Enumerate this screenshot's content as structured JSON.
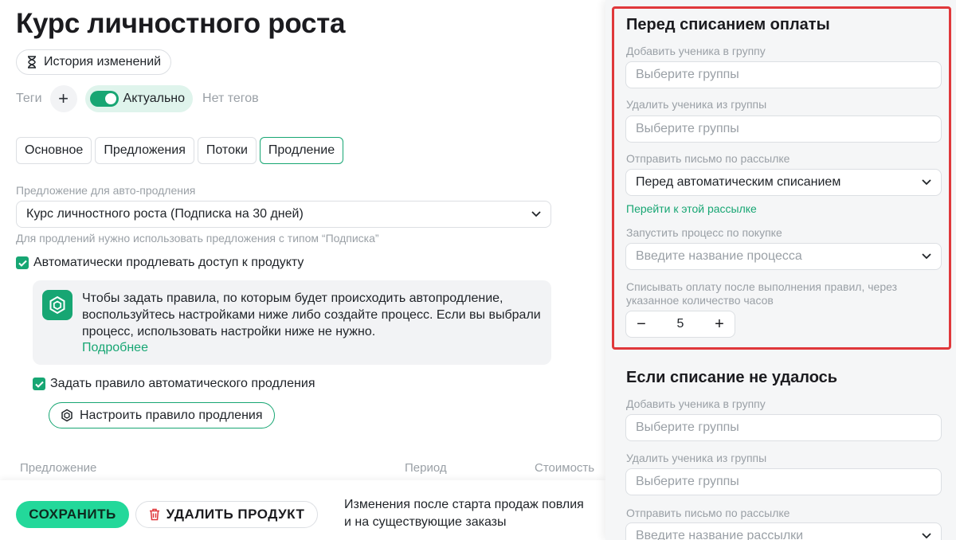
{
  "page": {
    "title": "Курс личностного роста",
    "history_label": "История изменений",
    "tags_label": "Теги",
    "tag_plus": "+",
    "toggle_label": "Актуально",
    "no_tags": "Нет тегов"
  },
  "tabs": [
    {
      "label": "Основное",
      "active": false
    },
    {
      "label": "Предложения",
      "active": false
    },
    {
      "label": "Потоки",
      "active": false
    },
    {
      "label": "Продление",
      "active": true
    }
  ],
  "renewal": {
    "offer_label": "Предложение для авто-продления",
    "offer_value": "Курс личностного роста (Подписка на 30 дней)",
    "offer_hint": "Для продлений нужно использовать предложения с типом “Подписка”",
    "auto_renew_label": "Автоматически продлевать доступ к продукту",
    "info_text": "Чтобы задать правила, по которым будет происходить автопродление, воспользуйтесь настройками ниже либо создайте процесс. Если вы выбрали процесс, использовать настройки ниже не нужно.",
    "info_link": "Подробнее",
    "set_rule_label": "Задать правило автоматического продления",
    "configure_rule_button": "Настроить правило продления"
  },
  "table": {
    "columns": [
      "Предложение",
      "Период",
      "Стоимость"
    ]
  },
  "bottom": {
    "save_label": "СОХРАНИТЬ",
    "delete_label": "УДАЛИТЬ ПРОДУКТ",
    "note_line1": "Изменения после старта продаж повлия",
    "note_line2": "и на существующие заказы"
  },
  "panel": {
    "before_charge": {
      "title": "Перед списанием оплаты",
      "add_group_label": "Добавить ученика в группу",
      "add_group_placeholder": "Выберите группы",
      "remove_group_label": "Удалить ученика из группы",
      "remove_group_placeholder": "Выберите группы",
      "send_email_label": "Отправить письмо по рассылке",
      "send_email_value": "Перед автоматическим списанием",
      "goto_mailing_link": "Перейти к этой рассылке",
      "process_label": "Запустить процесс по покупке",
      "process_placeholder": "Введите название процесса",
      "charge_after_label_line1": "Списывать оплату после выполнения правил, через",
      "charge_after_label_line2": "указанное количество часов",
      "hours_value": "5",
      "minus": "−",
      "plus": "+"
    },
    "charge_failed": {
      "title": "Если списание не удалось",
      "add_group_label": "Добавить ученика в группу",
      "add_group_placeholder": "Выберите группы",
      "remove_group_label": "Удалить ученика из группы",
      "remove_group_placeholder": "Выберите группы",
      "send_email_label": "Отправить письмо по рассылке",
      "send_email_placeholder": "Введите название рассылки"
    },
    "highlight_color": "#e0383b"
  },
  "colors": {
    "accent": "#17a673",
    "save_button": "#23d89a"
  }
}
